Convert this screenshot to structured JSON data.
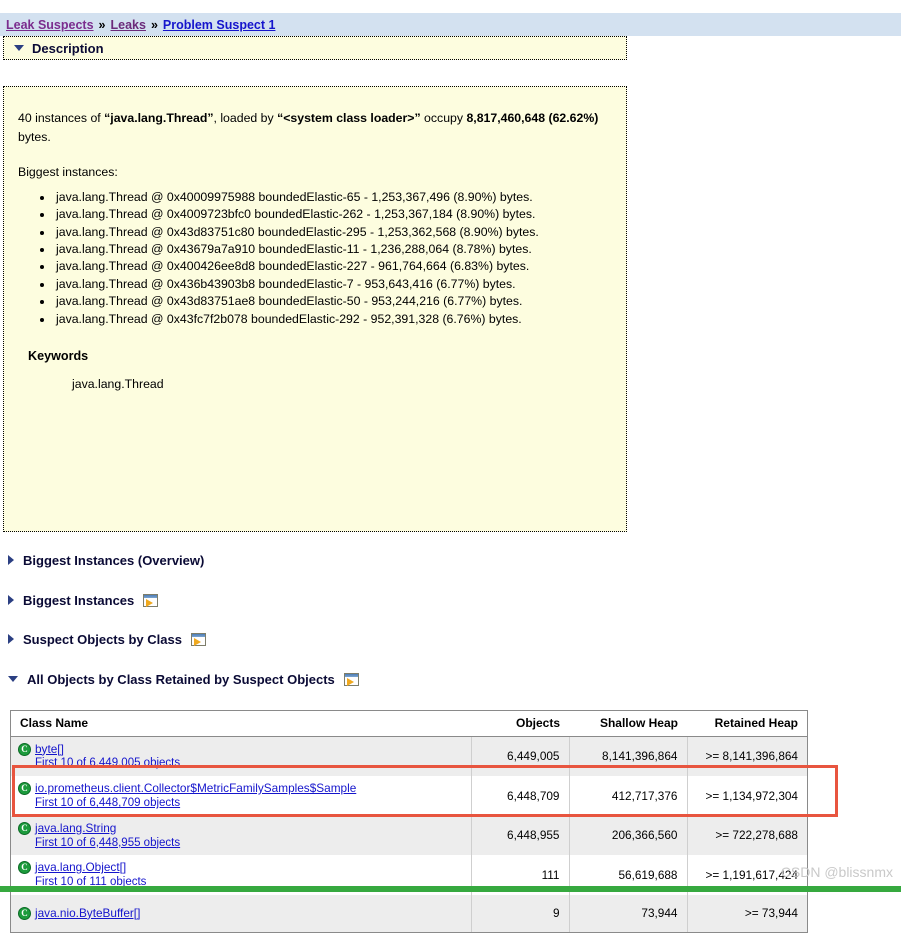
{
  "breadcrumb": {
    "items": [
      {
        "label": "Leak Suspects",
        "state": "visited"
      },
      {
        "label": "Leaks",
        "state": "visited"
      },
      {
        "label": "Problem Suspect 1",
        "state": "active"
      }
    ],
    "separator": "»",
    "background_color": "#d3e1f0"
  },
  "description_section": {
    "title": "Description",
    "expanded": true,
    "intro": {
      "count": "40",
      "prefix": "40 instances of ",
      "class_name": "“java.lang.Thread”",
      "middle": ", loaded by ",
      "loader": "“<system class loader>”",
      "occupy_word": " occupy ",
      "size": "8,817,460,648 (62.62%)",
      "suffix": " bytes.",
      "full_text": "40 instances of “java.lang.Thread”, loaded by “<system class loader>” occupy 8,817,460,648 (62.62%) bytes."
    },
    "biggest_instances_label": "Biggest instances:",
    "instances": [
      "java.lang.Thread @ 0x40009975988 boundedElastic-65 - 1,253,367,496 (8.90%) bytes.",
      "java.lang.Thread @ 0x4009723bfc0 boundedElastic-262 - 1,253,367,184 (8.90%) bytes.",
      "java.lang.Thread @ 0x43d83751c80 boundedElastic-295 - 1,253,362,568 (8.90%) bytes.",
      "java.lang.Thread @ 0x43679a7a910 boundedElastic-11 - 1,236,288,064 (8.78%) bytes.",
      "java.lang.Thread @ 0x400426ee8d8 boundedElastic-227 - 961,764,664 (6.83%) bytes.",
      "java.lang.Thread @ 0x436b43903b8 boundedElastic-7 - 953,643,416 (6.77%) bytes.",
      "java.lang.Thread @ 0x43d83751ae8 boundedElastic-50 - 953,244,216 (6.77%) bytes.",
      "java.lang.Thread @ 0x43fc7f2b078 boundedElastic-292 - 952,391,328 (6.76%) bytes."
    ],
    "keywords_title": "Keywords",
    "keywords_value": "java.lang.Thread",
    "background_color": "#fdfddf"
  },
  "sections": [
    {
      "title": "Biggest Instances (Overview)",
      "expanded": false,
      "has_open_icon": false
    },
    {
      "title": "Biggest Instances",
      "expanded": false,
      "has_open_icon": true
    },
    {
      "title": "Suspect Objects by Class",
      "expanded": false,
      "has_open_icon": true
    },
    {
      "title": "All Objects by Class Retained by Suspect Objects",
      "expanded": true,
      "has_open_icon": true
    }
  ],
  "table": {
    "columns": [
      "Class Name",
      "Objects",
      "Shallow Heap",
      "Retained Heap"
    ],
    "rows": [
      {
        "class_name": "byte[]",
        "sub_link": "First 10 of 6,449,005 objects",
        "objects": "6,449,005",
        "shallow_heap": "8,141,396,864",
        "retained_heap": ">= 8,141,396,864",
        "highlighted": false
      },
      {
        "class_name": "io.prometheus.client.Collector$MetricFamilySamples$Sample",
        "sub_link": "First 10 of 6,448,709 objects",
        "objects": "6,448,709",
        "shallow_heap": "412,717,376",
        "retained_heap": ">= 1,134,972,304",
        "highlighted": true
      },
      {
        "class_name": "java.lang.String",
        "sub_link": "First 10 of 6,448,955 objects",
        "objects": "6,448,955",
        "shallow_heap": "206,366,560",
        "retained_heap": ">= 722,278,688",
        "highlighted": false
      },
      {
        "class_name": "java.lang.Object[]",
        "sub_link": "First 10 of 111 objects",
        "objects": "111",
        "shallow_heap": "56,619,688",
        "retained_heap": ">= 1,191,617,424",
        "highlighted": false
      },
      {
        "class_name": "java.nio.ByteBuffer[]",
        "sub_link": "",
        "objects": "9",
        "shallow_heap": "73,944",
        "retained_heap": ">= 73,944",
        "highlighted": false
      }
    ],
    "row_icon": "class-icon",
    "row_icon_letter": "C",
    "link_color": "#1515cc"
  },
  "annotation": {
    "type": "red-rectangle-highlight",
    "color": "#e8553f",
    "target_row_index": 1
  },
  "watermark": "CSDN @blissnmx",
  "colors": {
    "breadcrumb_bg": "#d3e1f0",
    "panel_bg": "#fdfddf",
    "row_stripe": "#ededed",
    "bottom_strip": "#36a93f",
    "class_icon": "#1c9b3c"
  }
}
